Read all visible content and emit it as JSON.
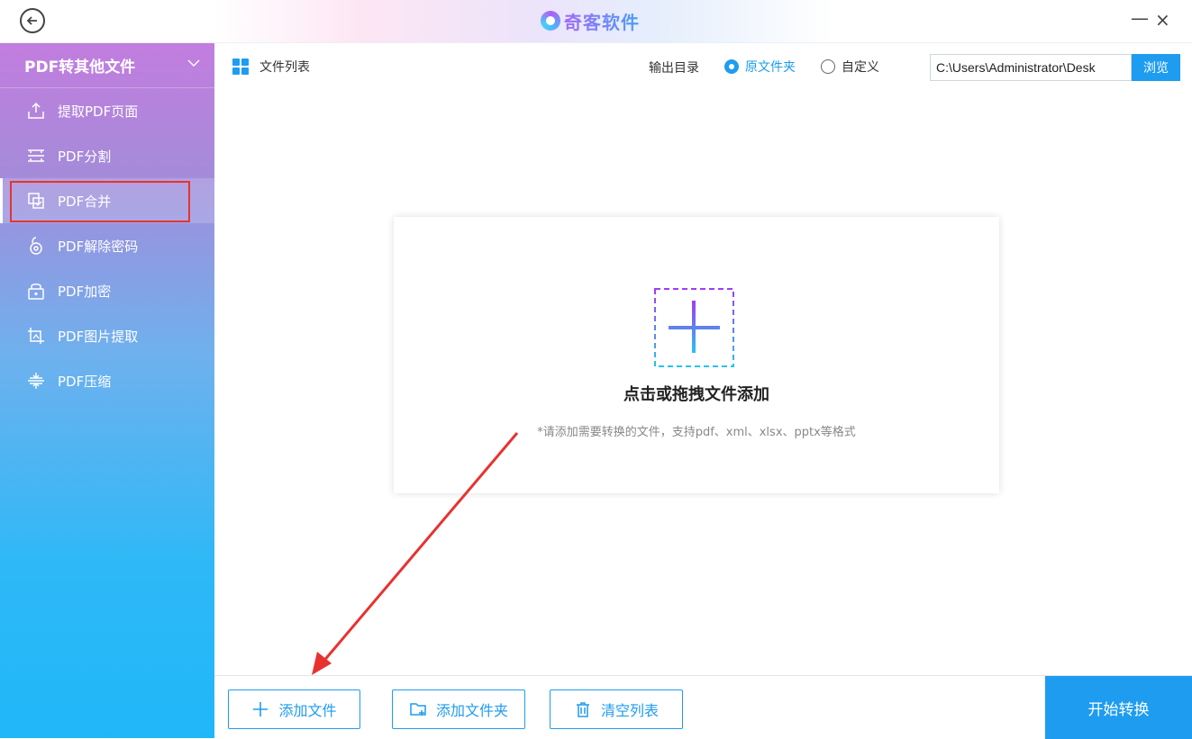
{
  "titlebar": {
    "brand": "奇客软件",
    "minimize": "—",
    "close": "×"
  },
  "sidebar": {
    "header": "PDF转其他文件",
    "items": [
      {
        "label": "提取PDF页面",
        "icon": "upload-icon"
      },
      {
        "label": "PDF分割",
        "icon": "split-icon"
      },
      {
        "label": "PDF合并",
        "icon": "merge-icon"
      },
      {
        "label": "PDF解除密码",
        "icon": "unlock-icon"
      },
      {
        "label": "PDF加密",
        "icon": "lock-icon"
      },
      {
        "label": "PDF图片提取",
        "icon": "crop-icon"
      },
      {
        "label": "PDF压缩",
        "icon": "compress-icon"
      }
    ],
    "active_index": 2
  },
  "toolbar": {
    "list_title": "文件列表",
    "output_label": "输出目录",
    "radio_original": "原文件夹",
    "radio_custom": "自定义",
    "path_value": "C:\\Users\\Administrator\\Desk",
    "browse_label": "浏览"
  },
  "dropzone": {
    "title": "点击或拖拽文件添加",
    "hint": "*请添加需要转换的文件，支持pdf、xml、xlsx、pptx等格式"
  },
  "bottom": {
    "add_file": "添加文件",
    "add_folder": "添加文件夹",
    "clear_list": "清空列表",
    "start": "开始转换"
  },
  "colors": {
    "accent": "#1e9cf0",
    "highlight": "#e8322f",
    "sidebar_top": "#c27ddf",
    "sidebar_bottom": "#20b7f9"
  }
}
